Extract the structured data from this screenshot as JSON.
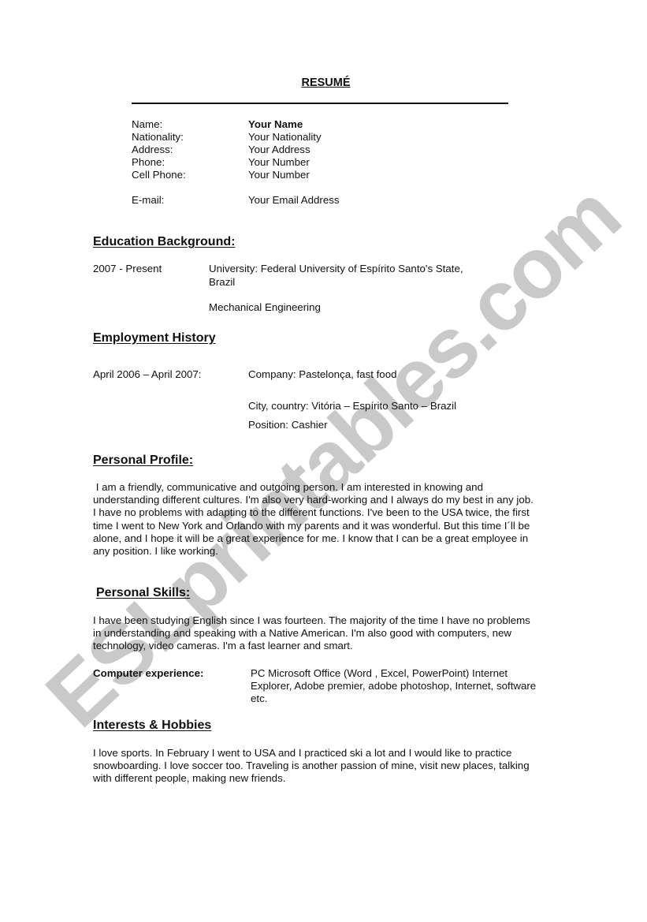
{
  "document": {
    "title": "RESUMÉ",
    "watermark": "ESLprintables.com"
  },
  "contact": {
    "fields": [
      {
        "label": "Name:",
        "value": "Your Name"
      },
      {
        "label": "Nationality:",
        "value": "Your Nationality"
      },
      {
        "label": "Address:",
        "value": "Your Address"
      },
      {
        "label": "Phone:",
        "value": "Your Number"
      },
      {
        "label": "Cell Phone:",
        "value": "Your Number"
      },
      {
        "label": "E-mail:",
        "value": "Your Email Address"
      }
    ]
  },
  "education": {
    "heading": "Education Background:",
    "period": "2007 - Present",
    "university_line1": "University: Federal University of Espírito Santo's State,",
    "university_line2": "Brazil",
    "course": "Mechanical Engineering"
  },
  "employment": {
    "heading": "Employment History",
    "period": "April 2006 – April 2007:",
    "company": "Company: Pastelonça, fast food",
    "city": "City, country: Vitória – Espírito Santo – Brazil",
    "position": "Position: Cashier"
  },
  "profile": {
    "heading": "Personal Profile:",
    "lines": [
      " I am a friendly, communicative and outgoing person. I am interested in knowing and",
      "understanding different cultures. I'm also very hard-working and I always do my best in any job.",
      "I have no problems with adapting to the different functions. I've been to the USA twice, the first",
      "time I went to New York and Orlando with my parents and it was wonderful. But this time I´ll be",
      "alone, and I hope it will be a great experience for me.  I know that I can be a great employee in",
      "any position. I like working."
    ]
  },
  "skills": {
    "heading": "Personal Skills:",
    "lines": [
      "I have been studying English since I was fourteen.  The majority of the time I have no problems",
      "in understanding and speaking with a Native American. I'm also good with computers, new",
      "technology, video cameras. I'm a fast learner and smart."
    ],
    "computer_label": "Computer experience:",
    "computer_lines": [
      "PC Microsoft Office (Word , Excel, PowerPoint) Internet",
      "Explorer, Adobe premier, adobe photoshop, Internet, software",
      "etc."
    ]
  },
  "hobbies": {
    "heading": "Interests & Hobbies",
    "lines": [
      "I love sports. In February I went to USA and I practiced ski a lot and I would like to practice",
      "snowboarding.  I love soccer too. Traveling is another passion of mine, visit new places, talking",
      "with different people, making new friends."
    ]
  }
}
